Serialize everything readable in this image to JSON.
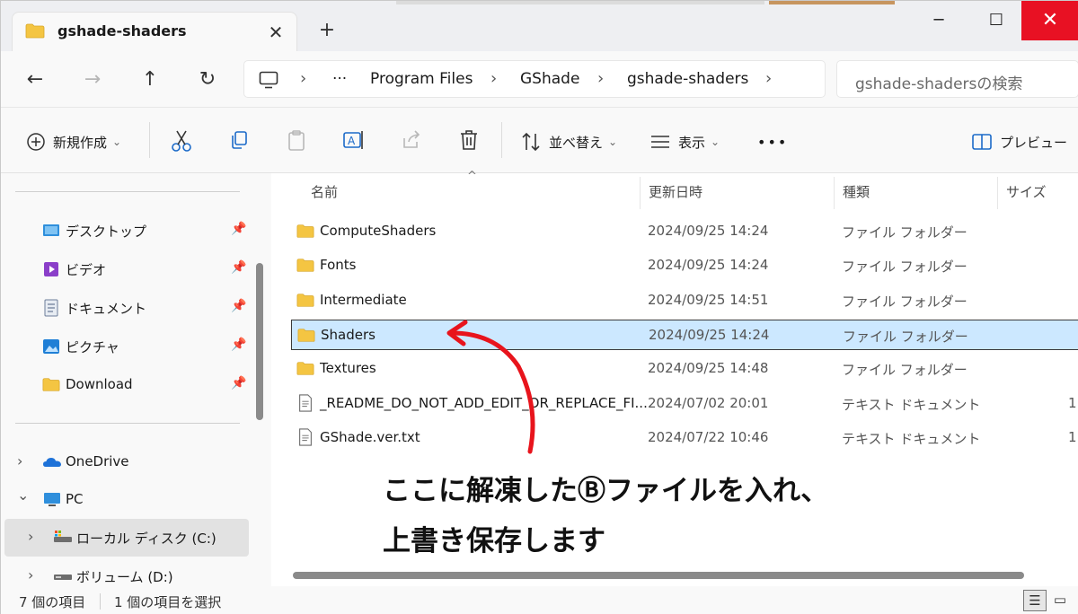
{
  "window": {
    "tab_title": "gshade-shaders",
    "tab_close": "✕",
    "new_tab": "+",
    "minimize": "─",
    "maximize": "☐",
    "close": "✕"
  },
  "nav": {
    "back": "←",
    "forward": "→",
    "up": "↑",
    "refresh": "↻",
    "breadcrumb": [
      "Program Files",
      "GShade",
      "gshade-shaders"
    ],
    "overflow": "···",
    "separator": "›",
    "search_placeholder": "gshade-shadersの検索"
  },
  "toolbar": {
    "new_label": "新規作成",
    "sort_label": "並べ替え",
    "view_label": "表示",
    "more": "•••",
    "preview_label": "プレビュー",
    "icons": [
      "cut-icon",
      "copy-icon",
      "paste-icon",
      "rename-icon",
      "share-icon",
      "delete-icon"
    ]
  },
  "sidebar": {
    "quick_access": [
      {
        "label": "デスクトップ",
        "icon": "desktop-icon"
      },
      {
        "label": "ビデオ",
        "icon": "video-icon"
      },
      {
        "label": "ドキュメント",
        "icon": "document-icon"
      },
      {
        "label": "ピクチャ",
        "icon": "picture-icon"
      },
      {
        "label": "Download",
        "icon": "folder-icon"
      }
    ],
    "onedrive": "OneDrive",
    "pc": "PC",
    "local_disk": "ローカル ディスク (C:)",
    "volume": "ボリューム (D:)",
    "pin": "📌",
    "expand": "›",
    "expanded": "⌄"
  },
  "columns": {
    "name": "名前",
    "date": "更新日時",
    "type": "種類",
    "size": "サイズ"
  },
  "files": [
    {
      "name": "ComputeShaders",
      "date": "2024/09/25 14:24",
      "type": "ファイル フォルダー",
      "size": "",
      "kind": "folder"
    },
    {
      "name": "Fonts",
      "date": "2024/09/25 14:24",
      "type": "ファイル フォルダー",
      "size": "",
      "kind": "folder"
    },
    {
      "name": "Intermediate",
      "date": "2024/09/25 14:51",
      "type": "ファイル フォルダー",
      "size": "",
      "kind": "folder"
    },
    {
      "name": "Shaders",
      "date": "2024/09/25 14:24",
      "type": "ファイル フォルダー",
      "size": "",
      "kind": "folder"
    },
    {
      "name": "Textures",
      "date": "2024/09/25 14:48",
      "type": "ファイル フォルダー",
      "size": "",
      "kind": "folder"
    },
    {
      "name": "_README_DO_NOT_ADD_EDIT_OR_REPLACE_FI...",
      "date": "2024/07/02 20:01",
      "type": "テキスト ドキュメント",
      "size": "1",
      "kind": "text"
    },
    {
      "name": "GShade.ver.txt",
      "date": "2024/07/22 10:46",
      "type": "テキスト ドキュメント",
      "size": "1",
      "kind": "text"
    }
  ],
  "selected_index": 3,
  "annotation": {
    "line1": "ここに解凍したⒷファイルを入れ、",
    "line2": "上書き保存します",
    "arrow_color": "#e8141c"
  },
  "status": {
    "count": "7 個の項目",
    "selected": "1 個の項目を選択"
  },
  "colors": {
    "selection": "#cce8ff",
    "close_button": "#e81123",
    "folder": "#f4c542"
  }
}
